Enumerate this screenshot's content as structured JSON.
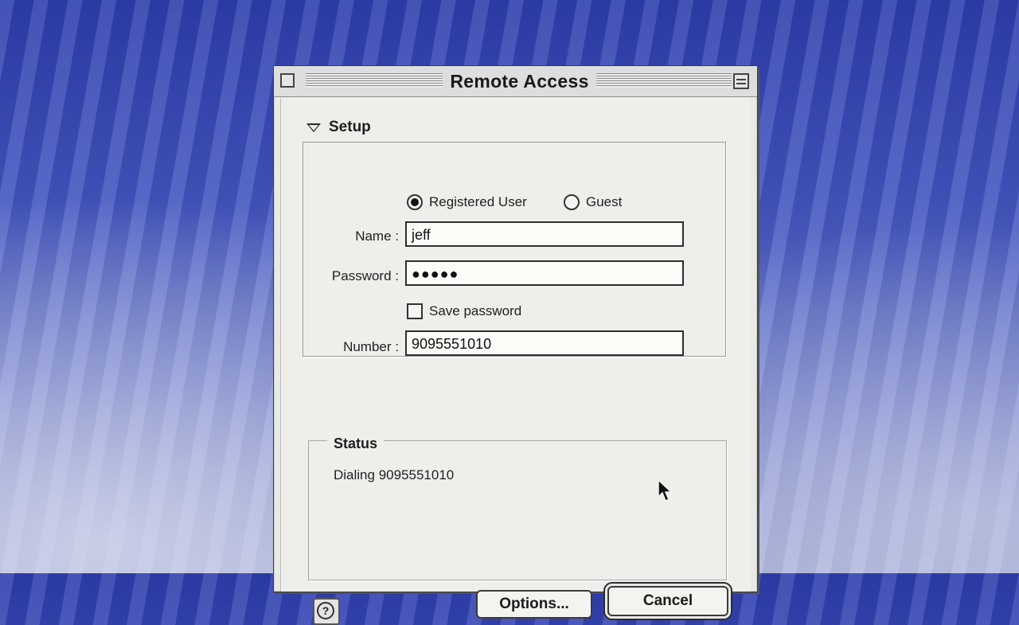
{
  "window": {
    "title": "Remote Access"
  },
  "setup": {
    "label": "Setup",
    "user_type": {
      "options": [
        "Registered User",
        "Guest"
      ],
      "selected": "Registered User"
    },
    "name_label": "Name :",
    "name_value": "jeff",
    "password_label": "Password :",
    "password_value": "●●●●●",
    "save_password_label": "Save password",
    "save_password_checked": false,
    "number_label": "Number :",
    "number_value": "9095551010"
  },
  "status": {
    "label": "Status",
    "message": "Dialing 9095551010"
  },
  "buttons": {
    "help": "?",
    "options": "Options...",
    "cancel": "Cancel"
  }
}
